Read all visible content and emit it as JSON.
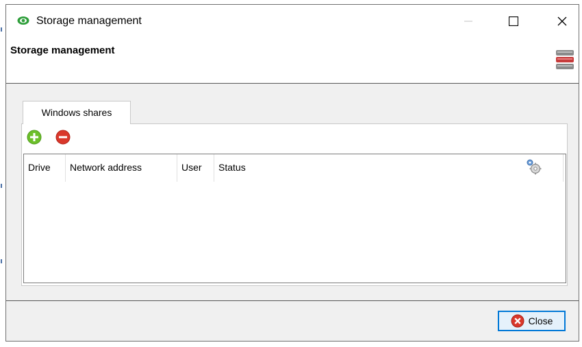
{
  "window": {
    "title": "Storage management"
  },
  "header": {
    "title": "Storage management",
    "icon": "database-icon"
  },
  "tabs": [
    {
      "label": "Windows shares",
      "active": true
    }
  ],
  "toolbar": {
    "add_icon": "add-icon",
    "remove_icon": "remove-icon"
  },
  "table": {
    "columns": [
      "Drive",
      "Network address",
      "User",
      "Status"
    ],
    "rows": [],
    "settings_icon": "gear-icon"
  },
  "footer": {
    "close_label": "Close"
  },
  "colors": {
    "accent": "#0078d7",
    "add_green": "#6cbf2a",
    "remove_red": "#d9372b"
  }
}
